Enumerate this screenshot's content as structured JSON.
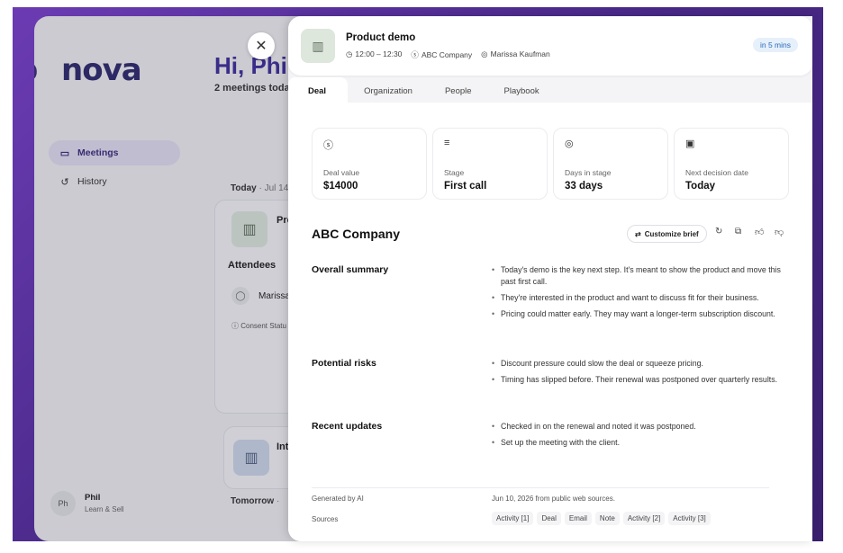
{
  "app": {
    "logo_text": "nova",
    "greeting": "Hi, Phil!",
    "greeting_sub": "2 meetings toda",
    "nav": [
      {
        "label": "Meetings"
      },
      {
        "label": "History"
      }
    ],
    "today_label": "Today",
    "today_date": "· Jul 14",
    "card1_title": "Pro",
    "attendees_label": "Attendees",
    "attendee_name": "Marissa",
    "consent_label": "Consent Statu",
    "card2_title": "Int",
    "tomorrow_label": "Tomorrow",
    "user": {
      "initials": "Ph",
      "name": "Phil",
      "role": "Learn & Sell"
    }
  },
  "drawer": {
    "title": "Product demo",
    "time": "12:00 – 12:30",
    "company": "ABC Company",
    "owner": "Marissa Kaufman",
    "badge": "in 5 mins",
    "tabs": [
      "Deal",
      "Organization",
      "People",
      "Playbook"
    ],
    "stats": [
      {
        "label": "Deal value",
        "value": "$14000",
        "icon": "dollar-icon"
      },
      {
        "label": "Stage",
        "value": "First call",
        "icon": "filter-icon"
      },
      {
        "label": "Days in stage",
        "value": "33 days",
        "icon": "target-icon"
      },
      {
        "label": "Next decision date",
        "value": "Today",
        "icon": "calendar-icon"
      }
    ],
    "company_title": "ABC Company",
    "customize_label": "Customize brief",
    "sections": [
      {
        "title": "Overall summary",
        "bullets": [
          "Today's demo is the key next step. It's meant to show the product and move this past first call.",
          "They're interested in the product and want to discuss fit for their business.",
          "Pricing could matter early. They may want a longer-term subscription discount."
        ]
      },
      {
        "title": "Potential risks",
        "bullets": [
          "Discount pressure could slow the deal or squeeze pricing.",
          "Timing has slipped before. Their renewal was postponed over quarterly results."
        ]
      },
      {
        "title": "Recent updates",
        "bullets": [
          "Checked in on the renewal and noted it was postponed.",
          "Set up the meeting with the client."
        ]
      }
    ],
    "generated_label": "Generated by AI",
    "generated_value": "Jun 10, 2026 from public web sources.",
    "sources_label": "Sources",
    "sources": [
      "Activity [1]",
      "Deal",
      "Email",
      "Note",
      "Activity [2]",
      "Activity [3]"
    ]
  }
}
